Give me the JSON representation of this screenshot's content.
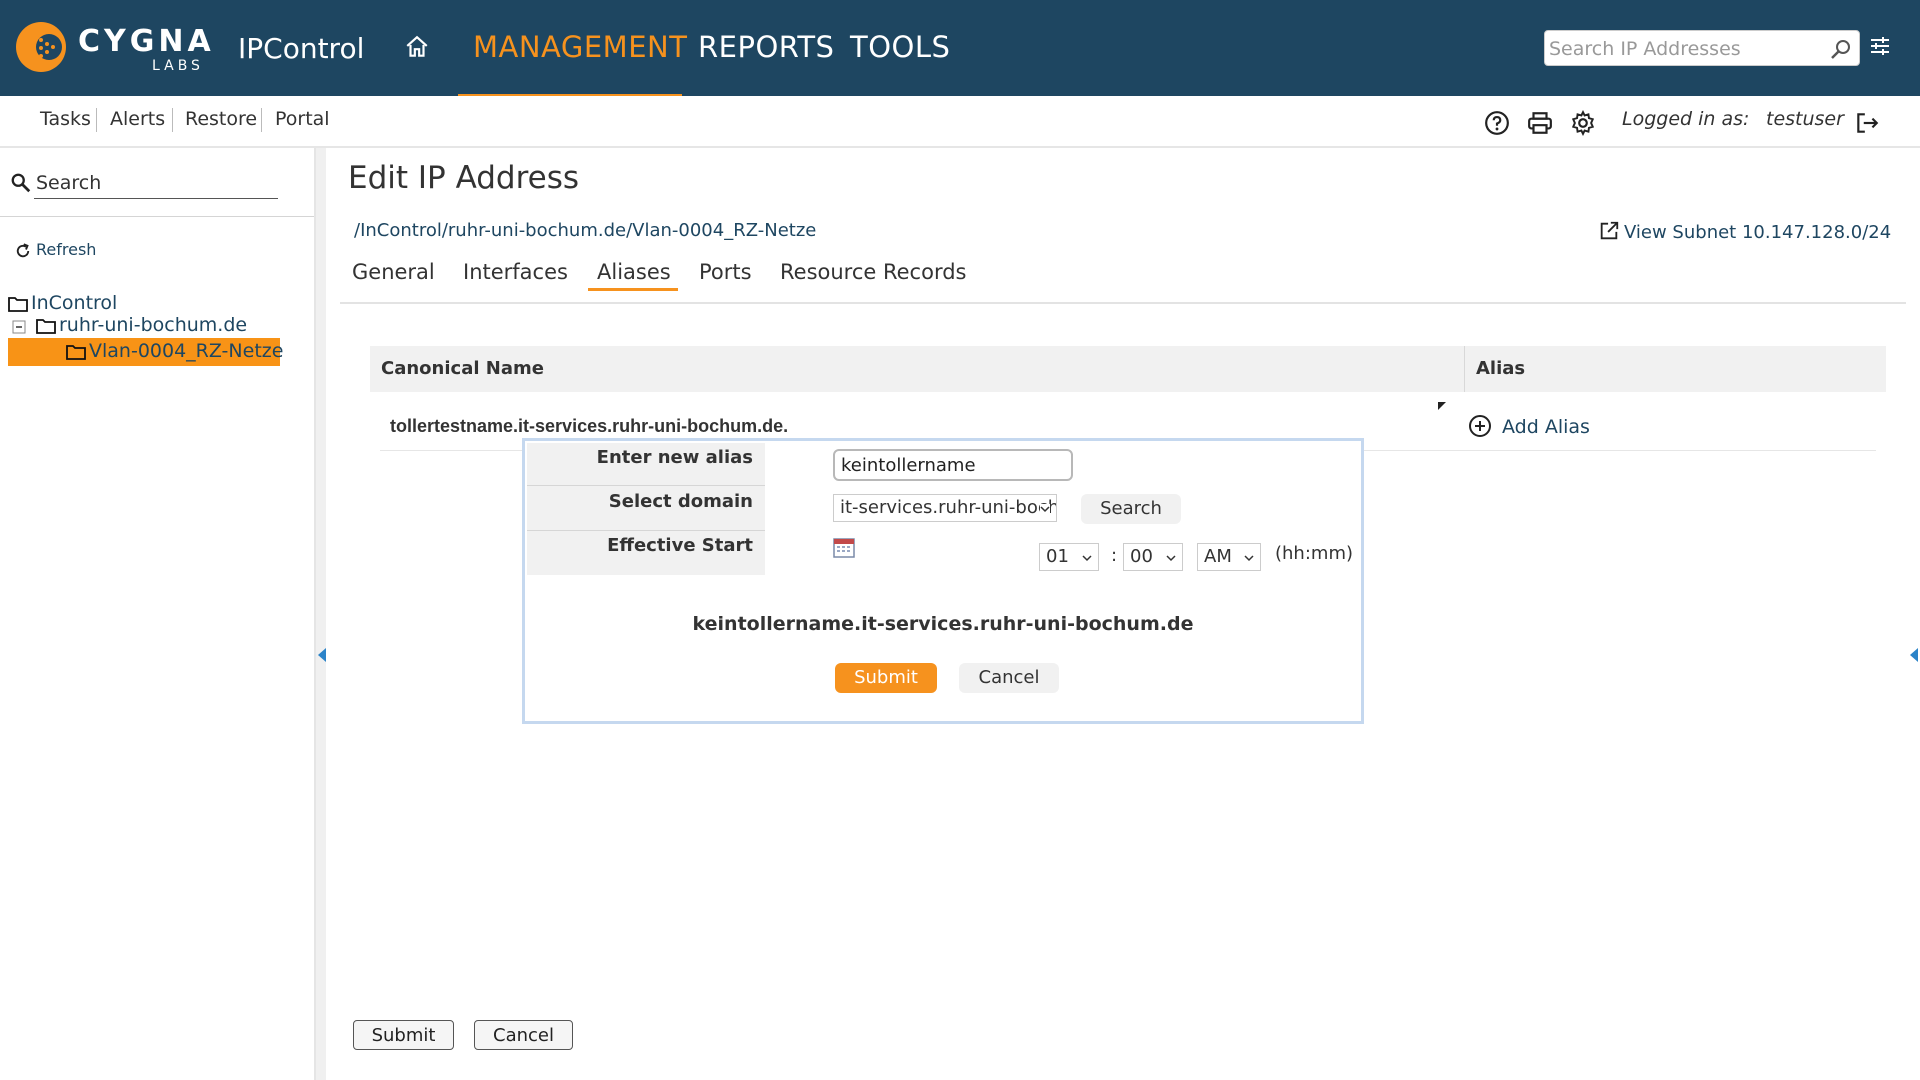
{
  "header": {
    "logo_word": "CYGNA",
    "logo_sub": "LABS",
    "app_name": "IPControl",
    "nav": [
      "MANAGEMENT",
      "REPORTS",
      "TOOLS"
    ],
    "active_nav": "MANAGEMENT",
    "search_placeholder": "Search IP Addresses",
    "accent_color": "#f6921e",
    "bg_color": "#1e4661"
  },
  "subnav": {
    "links": [
      "Tasks",
      "Alerts",
      "Restore",
      "Portal"
    ],
    "logged_in_label": "Logged in as:",
    "username": "testuser",
    "icons": [
      "help-icon",
      "print-icon",
      "settings-icon",
      "logout-icon"
    ]
  },
  "sidebar": {
    "search_placeholder": "Search",
    "refresh_label": "Refresh",
    "tree": [
      {
        "label": "InControl",
        "level": 0
      },
      {
        "label": "ruhr-uni-bochum.de",
        "level": 1
      },
      {
        "label": "Vlan-0004_RZ-Netze",
        "level": 2,
        "selected": true
      }
    ]
  },
  "main": {
    "title": "Edit IP Address",
    "breadcrumb": "/InControl/ruhr-uni-bochum.de/Vlan-0004_RZ-Netze",
    "view_subnet": "View Subnet 10.147.128.0/24",
    "tabs": [
      "General",
      "Interfaces",
      "Aliases",
      "Ports",
      "Resource Records"
    ],
    "active_tab": "Aliases",
    "table": {
      "headers": [
        "Canonical Name",
        "Alias"
      ],
      "canonical_name": "tollertestname.it-services.ruhr-uni-bochum.de.",
      "add_alias_label": "Add Alias"
    },
    "submit_label": "Submit",
    "cancel_label": "Cancel"
  },
  "popup": {
    "alias_label": "Enter new alias",
    "alias_value": "keintollername",
    "domain_label": "Select domain",
    "domain_value": "it-services.ruhr-uni-bochum.de",
    "search_label": "Search",
    "effective_label": "Effective Start",
    "hour": "01",
    "colon": ":",
    "minute": "00",
    "ampm": "AM",
    "time_hint": "(hh:mm)",
    "fqdn": "keintollername.it-services.ruhr-uni-bochum.de",
    "submit_label": "Submit",
    "cancel_label": "Cancel"
  }
}
